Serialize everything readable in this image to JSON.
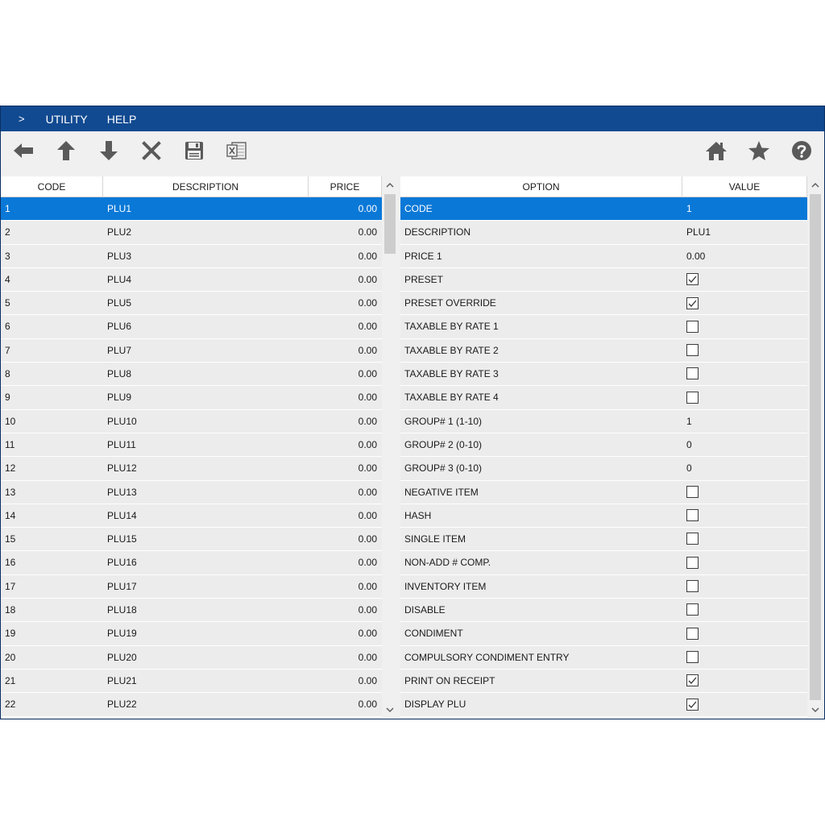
{
  "menu": {
    "caret": ">",
    "utility": "UTILITY",
    "help": "HELP"
  },
  "toolbar_icons": [
    "back-arrow-icon",
    "up-arrow-icon",
    "down-arrow-icon",
    "delete-x-icon",
    "save-disk-icon",
    "excel-export-icon",
    "home-icon",
    "star-icon",
    "help-icon"
  ],
  "left_table": {
    "headers": {
      "code": "CODE",
      "description": "DESCRIPTION",
      "price": "PRICE"
    },
    "rows": [
      {
        "code": "1",
        "description": "PLU1",
        "price": "0.00"
      },
      {
        "code": "2",
        "description": "PLU2",
        "price": "0.00"
      },
      {
        "code": "3",
        "description": "PLU3",
        "price": "0.00"
      },
      {
        "code": "4",
        "description": "PLU4",
        "price": "0.00"
      },
      {
        "code": "5",
        "description": "PLU5",
        "price": "0.00"
      },
      {
        "code": "6",
        "description": "PLU6",
        "price": "0.00"
      },
      {
        "code": "7",
        "description": "PLU7",
        "price": "0.00"
      },
      {
        "code": "8",
        "description": "PLU8",
        "price": "0.00"
      },
      {
        "code": "9",
        "description": "PLU9",
        "price": "0.00"
      },
      {
        "code": "10",
        "description": "PLU10",
        "price": "0.00"
      },
      {
        "code": "11",
        "description": "PLU11",
        "price": "0.00"
      },
      {
        "code": "12",
        "description": "PLU12",
        "price": "0.00"
      },
      {
        "code": "13",
        "description": "PLU13",
        "price": "0.00"
      },
      {
        "code": "14",
        "description": "PLU14",
        "price": "0.00"
      },
      {
        "code": "15",
        "description": "PLU15",
        "price": "0.00"
      },
      {
        "code": "16",
        "description": "PLU16",
        "price": "0.00"
      },
      {
        "code": "17",
        "description": "PLU17",
        "price": "0.00"
      },
      {
        "code": "18",
        "description": "PLU18",
        "price": "0.00"
      },
      {
        "code": "19",
        "description": "PLU19",
        "price": "0.00"
      },
      {
        "code": "20",
        "description": "PLU20",
        "price": "0.00"
      },
      {
        "code": "21",
        "description": "PLU21",
        "price": "0.00"
      },
      {
        "code": "22",
        "description": "PLU22",
        "price": "0.00"
      }
    ]
  },
  "right_table": {
    "headers": {
      "option": "OPTION",
      "value": "VALUE"
    },
    "rows": [
      {
        "option": "CODE",
        "type": "text",
        "value": "1"
      },
      {
        "option": "DESCRIPTION",
        "type": "text",
        "value": "PLU1"
      },
      {
        "option": "PRICE 1",
        "type": "text",
        "value": "0.00"
      },
      {
        "option": "PRESET",
        "type": "checkbox",
        "checked": true
      },
      {
        "option": "PRESET OVERRIDE",
        "type": "checkbox",
        "checked": true
      },
      {
        "option": "TAXABLE BY RATE 1",
        "type": "checkbox",
        "checked": false
      },
      {
        "option": "TAXABLE BY RATE 2",
        "type": "checkbox",
        "checked": false
      },
      {
        "option": "TAXABLE BY RATE 3",
        "type": "checkbox",
        "checked": false
      },
      {
        "option": "TAXABLE BY RATE 4",
        "type": "checkbox",
        "checked": false
      },
      {
        "option": "GROUP# 1 (1-10)",
        "type": "text",
        "value": "1"
      },
      {
        "option": "GROUP# 2 (0-10)",
        "type": "text",
        "value": "0"
      },
      {
        "option": "GROUP# 3 (0-10)",
        "type": "text",
        "value": "0"
      },
      {
        "option": "NEGATIVE ITEM",
        "type": "checkbox",
        "checked": false
      },
      {
        "option": "HASH",
        "type": "checkbox",
        "checked": false
      },
      {
        "option": "SINGLE ITEM",
        "type": "checkbox",
        "checked": false
      },
      {
        "option": "NON-ADD # COMP.",
        "type": "checkbox",
        "checked": false
      },
      {
        "option": "INVENTORY ITEM",
        "type": "checkbox",
        "checked": false
      },
      {
        "option": "DISABLE",
        "type": "checkbox",
        "checked": false
      },
      {
        "option": "CONDIMENT",
        "type": "checkbox",
        "checked": false
      },
      {
        "option": "COMPULSORY CONDIMENT ENTRY",
        "type": "checkbox",
        "checked": false
      },
      {
        "option": "PRINT ON RECEIPT",
        "type": "checkbox",
        "checked": true
      },
      {
        "option": "DISPLAY PLU",
        "type": "checkbox",
        "checked": true
      }
    ]
  },
  "selected_row_index": 0,
  "colors": {
    "menubar": "#114a91",
    "selection": "#0a78d7",
    "icon": "#5a5a5a"
  }
}
